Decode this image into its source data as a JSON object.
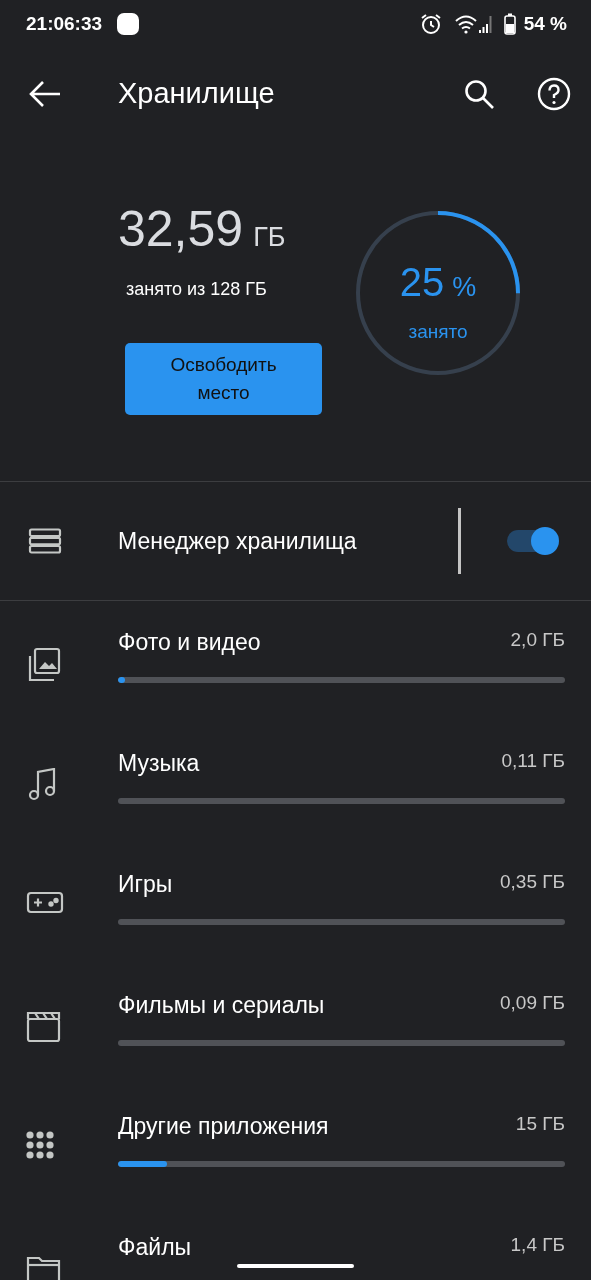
{
  "status_bar": {
    "time": "21:06:33",
    "battery": "54 %"
  },
  "app_bar": {
    "title": "Хранилище"
  },
  "summary": {
    "used": "32,59",
    "unit": "ГБ",
    "caption": "занято из 128 ГБ",
    "button": "Освободить место",
    "ring": {
      "level": 0.25,
      "percent": "25",
      "percent_sign": "%",
      "label": "занято"
    }
  },
  "manager": {
    "label": "Менеджер хранилища",
    "on": true
  },
  "categories": [
    {
      "kind": "photos",
      "name": "Фото и видео",
      "size": "2,0 ГБ",
      "level": 0.015
    },
    {
      "kind": "music",
      "name": "Музыка",
      "size": "0,11 ГБ",
      "level": 0
    },
    {
      "kind": "games",
      "name": "Игры",
      "size": "0,35 ГБ",
      "level": 0
    },
    {
      "kind": "movies",
      "name": "Фильмы и сериалы",
      "size": "0,09 ГБ",
      "level": 0
    },
    {
      "kind": "apps",
      "name": "Другие приложения",
      "size": "15 ГБ",
      "level": 0.11
    },
    {
      "kind": "files",
      "name": "Файлы",
      "size": "1,4 ГБ"
    }
  ]
}
